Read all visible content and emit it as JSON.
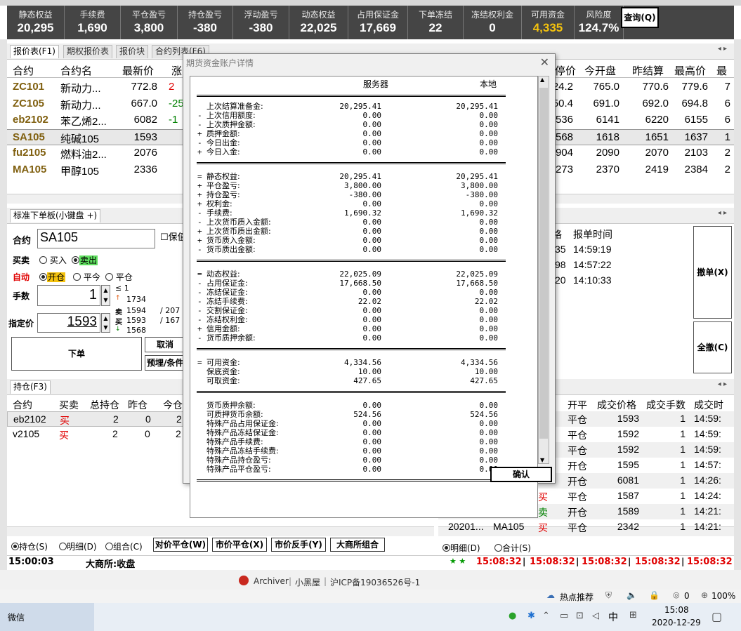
{
  "account": {
    "columns": [
      {
        "label": "静态权益",
        "value": "20,295"
      },
      {
        "label": "手续费",
        "value": "1,690"
      },
      {
        "label": "平仓盈亏",
        "value": "3,800"
      },
      {
        "label": "持仓盈亏",
        "value": "-380"
      },
      {
        "label": "浮动盈亏",
        "value": "-380"
      },
      {
        "label": "动态权益",
        "value": "22,025"
      },
      {
        "label": "占用保证金",
        "value": "17,669"
      },
      {
        "label": "下单冻结",
        "value": "22"
      },
      {
        "label": "冻结权利金",
        "value": "0"
      },
      {
        "label": "可用资金",
        "value": "4,335"
      },
      {
        "label": "风险度",
        "value": "124.7%"
      }
    ],
    "query_button": "查询(Q)",
    "highlight_color": "#f4c20d"
  },
  "quote_panel": {
    "tabs": [
      "报价表(F1)",
      "期权报价表",
      "报价块",
      "合约列表(F6)"
    ],
    "arrows": "◂ ▸",
    "headers_left": [
      "合约",
      "合约名",
      "最新价",
      "涨"
    ],
    "headers_right": [
      "停价",
      "今开盘",
      "昨结算",
      "最高价",
      "最"
    ],
    "rows": [
      {
        "code": "ZC101",
        "name": "新动力...",
        "last": "772.8",
        "chg": "2",
        "chg_color": "#e00000",
        "r1": "24.2",
        "r2": "765.0",
        "r3": "770.6",
        "r4": "779.6",
        "r5": "7"
      },
      {
        "code": "ZC105",
        "name": "新动力...",
        "last": "667.0",
        "chg": "-25",
        "chg_color": "#008000",
        "r1": "50.4",
        "r2": "691.0",
        "r3": "692.0",
        "r4": "694.8",
        "r5": "6"
      },
      {
        "code": "eb2102",
        "name": "苯乙烯2...",
        "last": "6082",
        "chg": "-1",
        "chg_color": "#008000",
        "r1": "536",
        "r2": "6141",
        "r3": "6220",
        "r4": "6155",
        "r5": "6"
      },
      {
        "code": "SA105",
        "name": "纯碱105",
        "last": "1593",
        "chg": "",
        "chg_color": "#000",
        "r1": "568",
        "r2": "1618",
        "r3": "1651",
        "r4": "1637",
        "r5": "1"
      },
      {
        "code": "fu2105",
        "name": "燃料油2...",
        "last": "2076",
        "chg": "",
        "chg_color": "#000",
        "r1": "904",
        "r2": "2090",
        "r3": "2070",
        "r4": "2103",
        "r5": "2"
      },
      {
        "code": "MA105",
        "name": "甲醇105",
        "last": "2336",
        "chg": "",
        "chg_color": "#000",
        "r1": "273",
        "r2": "2370",
        "r3": "2419",
        "r4": "2384",
        "r5": "2"
      }
    ]
  },
  "order_panel": {
    "tab": "标准下单板(小键盘 +)",
    "contract_label": "合约",
    "contract_value": "SA105",
    "checkbox_label": "保值",
    "side_label": "买卖",
    "buy_label": "买入",
    "sell_label": "卖出",
    "auto_label": "自动",
    "open_label": "开仓",
    "close_today_label": "平今",
    "close_label": "平仓",
    "qty_label": "手数",
    "qty_value": "1",
    "qty_max": "≤ 1",
    "upper_limit": "1734",
    "ask_label": "卖",
    "ask_price": "1594",
    "ask_vol": "207",
    "bid_label": "买",
    "bid_price": "1593",
    "bid_vol": "167",
    "lower_limit": "1568",
    "price_label": "指定价",
    "price_value": "1593",
    "submit": "下单",
    "cancel": "取消",
    "preset": "预埋/条件"
  },
  "order_list": {
    "headers": [
      "格",
      "报单时间"
    ],
    "rows": [
      {
        "p": "35",
        "t": "14:59:19"
      },
      {
        "p": "98",
        "t": "14:57:22"
      },
      {
        "p": "20",
        "t": "14:10:33"
      }
    ],
    "cancel_button": "撤单(X)",
    "cancel_all_button": "全撤(C)"
  },
  "positions": {
    "tab": "持仓(F3)",
    "headers": [
      "合约",
      "买卖",
      "总持仓",
      "昨仓",
      "今仓"
    ],
    "rows": [
      {
        "code": "eb2102",
        "side": "买",
        "total": "2",
        "yd": "0",
        "td": "2"
      },
      {
        "code": "v2105",
        "side": "买",
        "total": "2",
        "yd": "0",
        "td": "2"
      }
    ],
    "radio_hold": "持仓(S)",
    "radio_detail": "明细(D)",
    "radio_combo": "组合(C)",
    "btn_opp": "对价平仓(W)",
    "btn_mkt": "市价平仓(X)",
    "btn_rev": "市价反手(Y)",
    "btn_exch": "大商所组合"
  },
  "trades": {
    "headers": [
      "开平",
      "成交价格",
      "成交手数",
      "成交时"
    ],
    "rows": [
      {
        "code": "",
        "name": "",
        "side": "",
        "oc": "平仓",
        "price": "1593",
        "qty": "1",
        "time": "14:59:"
      },
      {
        "code": "",
        "name": "",
        "side": "",
        "oc": "平仓",
        "price": "1592",
        "qty": "1",
        "time": "14:59:"
      },
      {
        "code": "",
        "name": "",
        "side": "",
        "oc": "平仓",
        "price": "1592",
        "qty": "1",
        "time": "14:59:"
      },
      {
        "code": "",
        "name": "",
        "side": "",
        "oc": "开仓",
        "price": "1595",
        "qty": "1",
        "time": "14:57:"
      },
      {
        "code": "",
        "name": "",
        "side": "",
        "oc": "开仓",
        "price": "6081",
        "qty": "1",
        "time": "14:26:"
      },
      {
        "code": "20201...",
        "name": "SA105",
        "side": "买",
        "oc": "平仓",
        "price": "1587",
        "qty": "1",
        "time": "14:24:"
      },
      {
        "code": "20201...",
        "name": "SA105",
        "side": "卖",
        "oc": "开仓",
        "price": "1589",
        "qty": "1",
        "time": "14:21:"
      },
      {
        "code": "20201...",
        "name": "MA105",
        "side": "买",
        "oc": "平仓",
        "price": "2342",
        "qty": "1",
        "time": "14:21:"
      }
    ],
    "radio_detail": "明细(D)",
    "radio_total": "合计(S)"
  },
  "status_bar": {
    "time": "15:00:03",
    "exchange": "大商所:收盘",
    "clocks": [
      "15:08:32",
      "15:08:32",
      "15:08:32",
      "15:08:32",
      "15:08:32"
    ]
  },
  "dialog": {
    "title": "期货资金账户详情",
    "col_server": "服务器",
    "col_local": "本地",
    "sections": [
      [
        {
          "sign": "",
          "label": "上次结算准备金:",
          "server": "20,295.41",
          "local": "20,295.41"
        },
        {
          "sign": "-",
          "label": "上次信用额度:",
          "server": "0.00",
          "local": "0.00"
        },
        {
          "sign": "-",
          "label": "上次质押金额:",
          "server": "0.00",
          "local": "0.00"
        },
        {
          "sign": "+",
          "label": "质押金额:",
          "server": "0.00",
          "local": "0.00"
        },
        {
          "sign": "-",
          "label": "今日出金:",
          "server": "0.00",
          "local": "0.00"
        },
        {
          "sign": "+",
          "label": "今日入金:",
          "server": "0.00",
          "local": "0.00"
        }
      ],
      [
        {
          "sign": "=",
          "label": "静态权益:",
          "server": "20,295.41",
          "local": "20,295.41"
        },
        {
          "sign": "+",
          "label": "平仓盈亏:",
          "server": "3,800.00",
          "local": "3,800.00"
        },
        {
          "sign": "+",
          "label": "持仓盈亏:",
          "server": "-380.00",
          "local": "-380.00"
        },
        {
          "sign": "+",
          "label": "权利金:",
          "server": "0.00",
          "local": "0.00"
        },
        {
          "sign": "-",
          "label": "手续费:",
          "server": "1,690.32",
          "local": "1,690.32"
        },
        {
          "sign": "-",
          "label": "上次货币质入金额:",
          "server": "0.00",
          "local": "0.00"
        },
        {
          "sign": "+",
          "label": "上次货币质出金额:",
          "server": "0.00",
          "local": "0.00"
        },
        {
          "sign": "+",
          "label": "货币质入金额:",
          "server": "0.00",
          "local": "0.00"
        },
        {
          "sign": "-",
          "label": "货币质出金额:",
          "server": "0.00",
          "local": "0.00"
        }
      ],
      [
        {
          "sign": "=",
          "label": "动态权益:",
          "server": "22,025.09",
          "local": "22,025.09"
        },
        {
          "sign": "-",
          "label": "占用保证金:",
          "server": "17,668.50",
          "local": "17,668.50"
        },
        {
          "sign": "-",
          "label": "冻结保证金:",
          "server": "0.00",
          "local": "0.00"
        },
        {
          "sign": "-",
          "label": "冻结手续费:",
          "server": "22.02",
          "local": "22.02"
        },
        {
          "sign": "-",
          "label": "交割保证金:",
          "server": "0.00",
          "local": "0.00"
        },
        {
          "sign": "-",
          "label": "冻结权利金:",
          "server": "0.00",
          "local": "0.00"
        },
        {
          "sign": "+",
          "label": "信用金额:",
          "server": "0.00",
          "local": "0.00"
        },
        {
          "sign": "-",
          "label": "货币质押余额:",
          "server": "0.00",
          "local": "0.00"
        }
      ],
      [
        {
          "sign": "=",
          "label": "可用资金:",
          "server": "4,334.56",
          "local": "4,334.56"
        },
        {
          "sign": "",
          "label": "保底资金:",
          "server": "10.00",
          "local": "10.00"
        },
        {
          "sign": "",
          "label": "可取资金:",
          "server": "427.65",
          "local": "427.65"
        }
      ],
      [
        {
          "sign": "",
          "label": "货币质押余额:",
          "server": "0.00",
          "local": "0.00"
        },
        {
          "sign": "",
          "label": "可质押货币余额:",
          "server": "524.56",
          "local": "524.56"
        },
        {
          "sign": "",
          "label": "特殊产品占用保证金:",
          "server": "0.00",
          "local": "0.00"
        },
        {
          "sign": "",
          "label": "特殊产品冻结保证金:",
          "server": "0.00",
          "local": "0.00"
        },
        {
          "sign": "",
          "label": "特殊产品手续费:",
          "server": "0.00",
          "local": "0.00"
        },
        {
          "sign": "",
          "label": "特殊产品冻结手续费:",
          "server": "0.00",
          "local": "0.00"
        },
        {
          "sign": "",
          "label": "特殊产品持仓盈亏:",
          "server": "0.00",
          "local": "0.00"
        },
        {
          "sign": "",
          "label": "特殊产品平仓盈亏:",
          "server": "0.00",
          "local": "0.00"
        }
      ]
    ],
    "ok": "确认"
  },
  "footer": {
    "archiver": "Archiver",
    "sep": "|",
    "blackroom": "小黑屋",
    "icp": "沪ICP备19036526号-1"
  },
  "taskbar": {
    "hot": "热点推荐",
    "cloud_count": "0",
    "zoom": "100%",
    "wechat": "微信",
    "ime": "中",
    "time": "15:08",
    "date": "2020-12-29"
  }
}
